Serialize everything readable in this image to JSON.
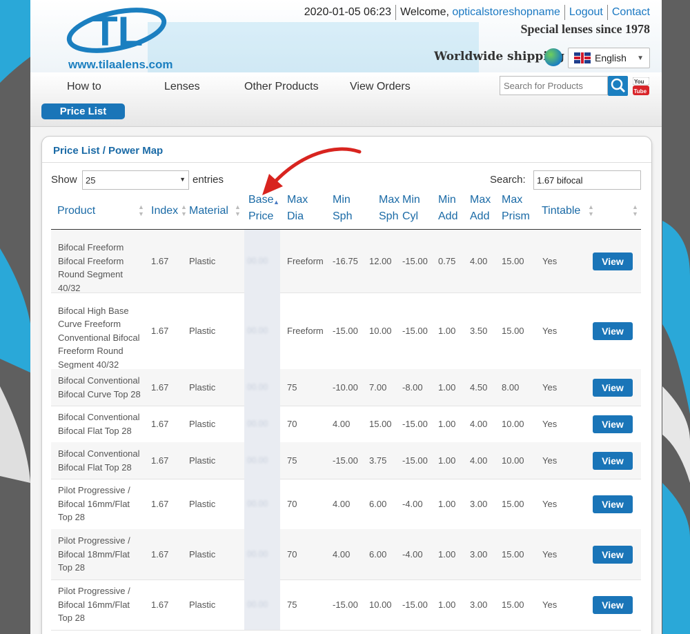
{
  "header": {
    "logo_url": "www.tilaalens.com",
    "datetime": "2020-01-05 06:23",
    "welcome_prefix": "Welcome,",
    "username": "opticalstoreshopname",
    "logout": "Logout",
    "contact": "Contact",
    "tagline": "Special lenses since 1978",
    "shipping": "Worldwide shipping",
    "language": "English"
  },
  "nav": {
    "items": [
      "How to",
      "Lenses",
      "Other Products",
      "View Orders"
    ],
    "active": "Price List",
    "search_placeholder": "Search for Products"
  },
  "panel": {
    "title": "Price List / Power Map",
    "show_label": "Show",
    "entries_value": "25",
    "entries_label": "entries",
    "search_label": "Search:",
    "search_value": "1.67 bifocal"
  },
  "table": {
    "headers": {
      "product": "Product",
      "index": "Index",
      "material": "Material",
      "base_price_1": "Base",
      "base_price_2": "Price",
      "max_dia_1": "Max",
      "max_dia_2": "Dia",
      "min_sph_1": "Min",
      "min_sph_2": "Sph",
      "max_sph_1": "Max",
      "max_sph_2": "Sph",
      "min_cyl_1": "Min",
      "min_cyl_2": "Cyl",
      "min_add_1": "Min",
      "min_add_2": "Add",
      "max_add_1": "Max",
      "max_add_2": "Add",
      "max_prism_1": "Max",
      "max_prism_2": "Prism",
      "tintable": "Tintable"
    },
    "rows": [
      {
        "product": "Bifocal Freeform Bifocal Freeform Round Segment 40/32",
        "index": "1.67",
        "material": "Plastic",
        "price": "00.00",
        "dia": "Freeform",
        "min_sph": "-16.75",
        "max_sph": "12.00",
        "min_cyl": "-15.00",
        "min_add": "0.75",
        "max_add": "4.00",
        "max_prism": "15.00",
        "tintable": "Yes",
        "action": "View"
      },
      {
        "product": "Bifocal High Base Curve Freeform Conventional Bifocal Freeform Round Segment 40/32",
        "index": "1.67",
        "material": "Plastic",
        "price": "00.00",
        "dia": "Freeform",
        "min_sph": "-15.00",
        "max_sph": "10.00",
        "min_cyl": "-15.00",
        "min_add": "1.00",
        "max_add": "3.50",
        "max_prism": "15.00",
        "tintable": "Yes",
        "action": "View"
      },
      {
        "product": "Bifocal Conventional Bifocal Curve Top 28",
        "index": "1.67",
        "material": "Plastic",
        "price": "00.00",
        "dia": "75",
        "min_sph": "-10.00",
        "max_sph": "7.00",
        "min_cyl": "-8.00",
        "min_add": "1.00",
        "max_add": "4.50",
        "max_prism": "8.00",
        "tintable": "Yes",
        "action": "View"
      },
      {
        "product": "Bifocal Conventional Bifocal Flat Top 28",
        "index": "1.67",
        "material": "Plastic",
        "price": "00.00",
        "dia": "70",
        "min_sph": "4.00",
        "max_sph": "15.00",
        "min_cyl": "-15.00",
        "min_add": "1.00",
        "max_add": "4.00",
        "max_prism": "10.00",
        "tintable": "Yes",
        "action": "View"
      },
      {
        "product": "Bifocal Conventional Bifocal Flat Top 28",
        "index": "1.67",
        "material": "Plastic",
        "price": "00.00",
        "dia": "75",
        "min_sph": "-15.00",
        "max_sph": "3.75",
        "min_cyl": "-15.00",
        "min_add": "1.00",
        "max_add": "4.00",
        "max_prism": "10.00",
        "tintable": "Yes",
        "action": "View"
      },
      {
        "product": "Pilot Progressive / Bifocal 16mm/Flat Top 28",
        "index": "1.67",
        "material": "Plastic",
        "price": "00.00",
        "dia": "70",
        "min_sph": "4.00",
        "max_sph": "6.00",
        "min_cyl": "-4.00",
        "min_add": "1.00",
        "max_add": "3.00",
        "max_prism": "15.00",
        "tintable": "Yes",
        "action": "View"
      },
      {
        "product": "Pilot Progressive / Bifocal 18mm/Flat Top 28",
        "index": "1.67",
        "material": "Plastic",
        "price": "00.00",
        "dia": "70",
        "min_sph": "4.00",
        "max_sph": "6.00",
        "min_cyl": "-4.00",
        "min_add": "1.00",
        "max_add": "3.00",
        "max_prism": "15.00",
        "tintable": "Yes",
        "action": "View"
      },
      {
        "product": "Pilot Progressive / Bifocal 16mm/Flat Top 28",
        "index": "1.67",
        "material": "Plastic",
        "price": "00.00",
        "dia": "75",
        "min_sph": "-15.00",
        "max_sph": "10.00",
        "min_cyl": "-15.00",
        "min_add": "1.00",
        "max_add": "3.00",
        "max_prism": "15.00",
        "tintable": "Yes",
        "action": "View"
      }
    ]
  }
}
